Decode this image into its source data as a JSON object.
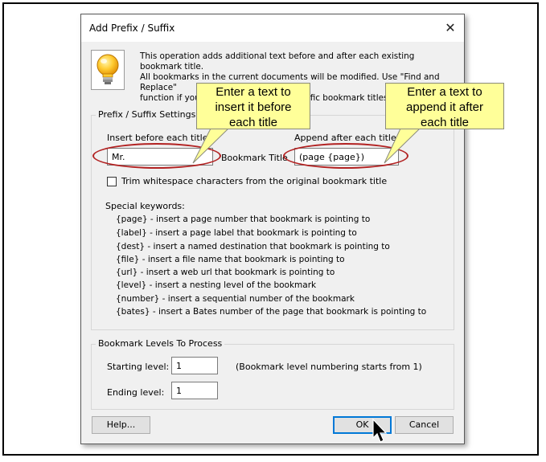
{
  "dialog": {
    "title": "Add Prefix / Suffix",
    "close_glyph": "✕",
    "intro_lines": [
      "This operation adds additional text before and after each existing bookmark title.",
      "All bookmarks in the current documents will be modified. Use \"Find and Replace\"",
      "function if you want to modify only specific bookmark titles."
    ]
  },
  "settings": {
    "group_label": "Prefix / Suffix Settings",
    "insert_label": "Insert before each title:",
    "insert_value": "Mr.",
    "bookmark_title_label": "Bookmark Title",
    "append_label": "Append after each title:",
    "append_value": "(page {page})",
    "trim_label": "Trim whitespace characters from the original bookmark title",
    "trim_checked": false,
    "keywords_heading": "Special keywords:",
    "keywords": [
      "{page} - insert a page number that bookmark is pointing to",
      "{label} - insert a page label that bookmark is pointing to",
      "{dest} - insert a named destination that bookmark is pointing to",
      "{file} - insert a file name that bookmark is pointing to",
      "{url} - insert a web url that bookmark is pointing to",
      "{level} - insert a nesting level of the bookmark",
      "{number} - insert a sequential number of the bookmark",
      "{bates} - insert a Bates number of the page that bookmark is pointing to"
    ]
  },
  "levels": {
    "group_label": "Bookmark Levels To Process",
    "starting_label": "Starting level:",
    "starting_value": "1",
    "note": "(Bookmark level numbering starts from 1)",
    "ending_label": "Ending level:",
    "ending_value": "1"
  },
  "buttons": {
    "help": "Help...",
    "ok": "OK",
    "cancel": "Cancel"
  },
  "callouts": {
    "left": [
      "Enter a text to",
      "insert it before",
      "each title"
    ],
    "right": [
      "Enter a text to",
      "append it after",
      "each title"
    ]
  },
  "colors": {
    "callout_fill": "#ffff99",
    "highlight_ellipse": "#b22222",
    "default_button_border": "#0078d7"
  }
}
